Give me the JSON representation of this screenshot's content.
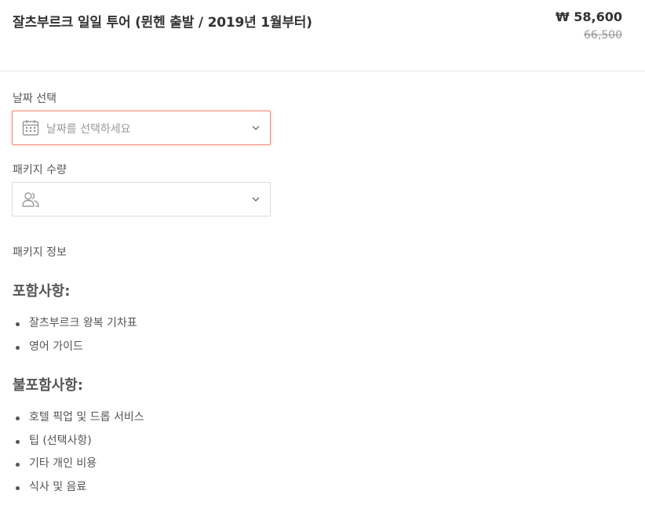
{
  "product": {
    "title": "잘츠부르크 일일 투어 (뮌헨 출발 / 2019년 1월부터)",
    "price": "₩ 58,600",
    "original_price": "66,500"
  },
  "date_select": {
    "label": "날짜 선택",
    "placeholder": "날짜를 선택하세요",
    "icon": "calendar-icon"
  },
  "package_qty": {
    "label": "패키지 수량",
    "value": "",
    "icon": "users-icon"
  },
  "package_info": {
    "label": "패키지 정보",
    "included_heading": "포함사항:",
    "included": [
      "잘츠부르크 왕복 기차표",
      "영어 가이드"
    ],
    "excluded_heading": "불포함사항:",
    "excluded": [
      "호텔 픽업 및 드롭 서비스",
      "팁 (선택사항)",
      "기타 개인 비용",
      "식사 및 음료"
    ]
  },
  "colors": {
    "focus_border": "#f58f7c",
    "text": "#333333",
    "muted": "#999999"
  }
}
